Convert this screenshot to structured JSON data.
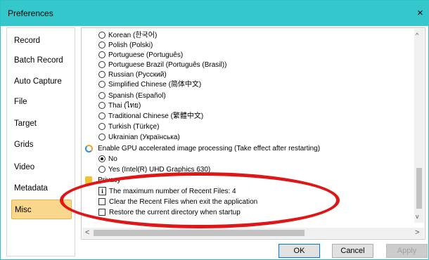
{
  "window": {
    "title": "Preferences",
    "close_glyph": "×"
  },
  "sidebar": {
    "items": [
      {
        "label": "Record"
      },
      {
        "label": "Batch Record"
      },
      {
        "label": "Auto Capture"
      },
      {
        "label": "File"
      },
      {
        "label": "Target"
      },
      {
        "label": "Grids"
      },
      {
        "label": "Video"
      },
      {
        "label": "Metadata"
      },
      {
        "label": "Misc",
        "selected": true
      }
    ]
  },
  "languages": [
    "Korean (한국어)",
    "Polish (Polski)",
    "Portuguese (Português)",
    "Portuguese Brazil (Português (Brasil))",
    "Russian (Русский)",
    "Simplified Chinese (简体中文)",
    "Spanish (Español)",
    "Thai (ไทย)",
    "Traditional Chinese (繁體中文)",
    "Turkish (Türkçe)",
    "Ukrainian (Українська)"
  ],
  "gpu": {
    "label": "Enable GPU accelerated image processing (Take effect after restarting)",
    "options": [
      "No",
      "Yes (Intel(R) UHD Graphics 630)"
    ],
    "selected": "No"
  },
  "privacy": {
    "label": "Privacy",
    "max_recent": "The maximum number of Recent Files: 4",
    "clear_recent": "Clear the Recent Files when exit the application",
    "restore_dir": "Restore the current directory when startup"
  },
  "buttons": {
    "ok": "OK",
    "cancel": "Cancel",
    "apply": "Apply"
  },
  "scroll": {
    "up": "^",
    "down": "v",
    "left": "<",
    "right": ">"
  },
  "colors": {
    "titlebar": "#34c8cc",
    "selected_item": "#f9d78c",
    "annotation": "#e01616"
  }
}
